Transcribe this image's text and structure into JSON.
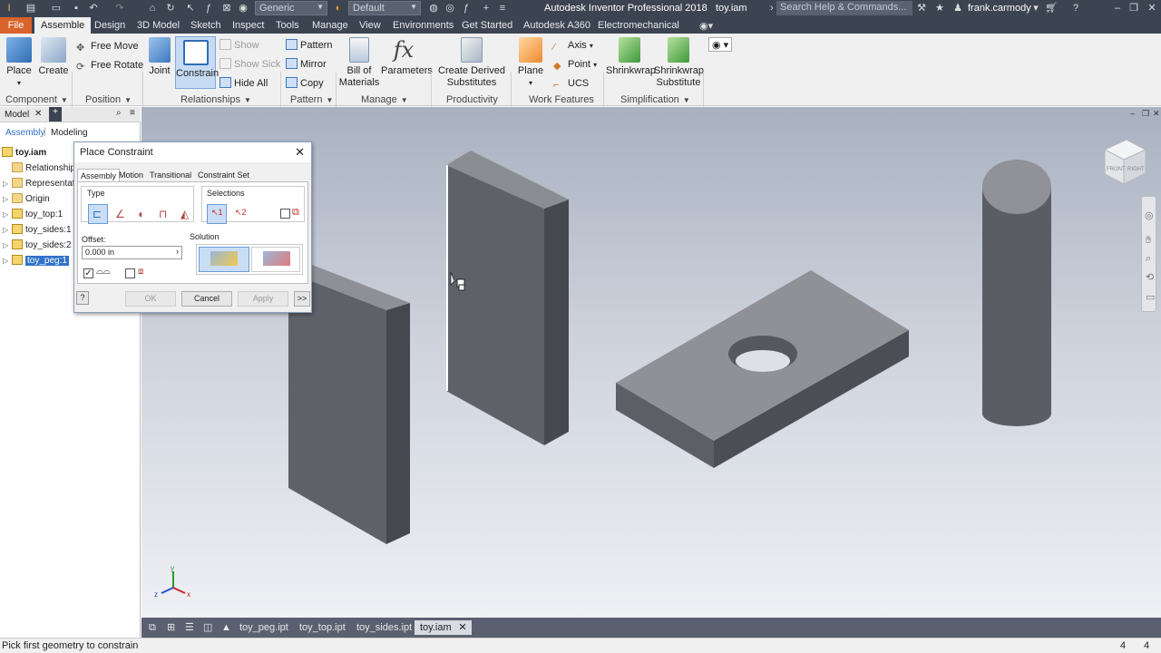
{
  "titlebar": {
    "title": "Autodesk Inventor Professional 2018",
    "file": "toy.iam",
    "material": "Generic",
    "appearance": "Default",
    "search_placeholder": "Search Help & Commands...",
    "user": "frank.carmody"
  },
  "menu": {
    "file": "File",
    "tabs": [
      "Assemble",
      "Design",
      "3D Model",
      "Sketch",
      "Inspect",
      "Tools",
      "Manage",
      "View",
      "Environments",
      "Get Started",
      "Autodesk A360",
      "Electromechanical"
    ]
  },
  "ribbon": {
    "component": {
      "place": "Place",
      "create": "Create",
      "group": "Component"
    },
    "position": {
      "free_move": "Free Move",
      "free_rotate": "Free Rotate",
      "group": "Position"
    },
    "relationships": {
      "joint": "Joint",
      "constrain": "Constrain",
      "show": "Show",
      "show_sick": "Show Sick",
      "hide_all": "Hide All",
      "group": "Relationships"
    },
    "pattern": {
      "pattern": "Pattern",
      "mirror": "Mirror",
      "copy": "Copy",
      "group": "Pattern"
    },
    "manage": {
      "bom_line1": "Bill of",
      "bom_line2": "Materials",
      "parameters": "Parameters",
      "group": "Manage"
    },
    "productivity": {
      "line1": "Create Derived",
      "line2": "Substitutes",
      "group": "Productivity"
    },
    "work_features": {
      "plane": "Plane",
      "axis": "Axis",
      "point": "Point",
      "ucs": "UCS",
      "group": "Work Features"
    },
    "simplification": {
      "shrinkwrap": "Shrinkwrap",
      "sw_sub_line1": "Shrinkwrap",
      "sw_sub_line2": "Substitute",
      "group": "Simplification"
    }
  },
  "browser": {
    "title": "Model",
    "tab_assembly": "Assembly",
    "tab_modeling": "Modeling",
    "root": "toy.iam",
    "items": [
      "Relationships",
      "Representations",
      "Origin",
      "toy_top:1",
      "toy_sides:1",
      "toy_sides:2",
      "toy_peg:1"
    ]
  },
  "dialog": {
    "title": "Place Constraint",
    "tabs": [
      "Assembly",
      "Motion",
      "Transitional",
      "Constraint Set"
    ],
    "type_label": "Type",
    "selections_label": "Selections",
    "sel1": "1",
    "sel2": "2",
    "offset_label": "Offset:",
    "offset_value": "0.000 in",
    "solution_label": "Solution",
    "ok": "OK",
    "cancel": "Cancel",
    "apply": "Apply",
    "more": ">>"
  },
  "viewport": {
    "viewcube_front": "FRONT",
    "viewcube_right": "RIGHT",
    "axis_x": "x",
    "axis_y": "y",
    "axis_z": "z"
  },
  "doc_tabs": [
    "toy_peg.ipt",
    "toy_top.ipt",
    "toy_sides.ipt",
    "toy.iam"
  ],
  "status": {
    "prompt": "Pick first geometry to constrain",
    "count1": "4",
    "count2": "4"
  },
  "colors": {
    "file_tab": "#d8632b",
    "selection": "#3072c9",
    "titlebar": "#3c4452"
  }
}
